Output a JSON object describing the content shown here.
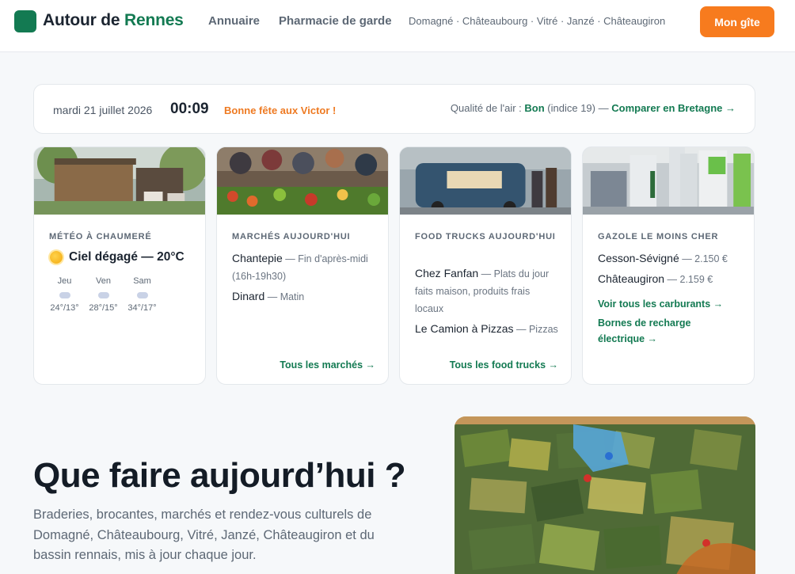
{
  "header": {
    "logo_text_a": "Autour de ",
    "logo_text_b": "Rennes",
    "nav": [
      {
        "label": "Annuaire"
      },
      {
        "label": "Pharmacie de garde"
      }
    ],
    "cities": "Domagné · Châteaubourg · Vitré · Janzé · Châteaugiron",
    "cta_label": "Mon gîte",
    "colors": {
      "brand": "#137a52",
      "accent": "#f77b1e"
    }
  },
  "infobar": {
    "date": "mardi 21 juillet 2026",
    "time": "00:09",
    "fete": "Bonne fête aux Victor !",
    "air_prefix": "Qualité de l'air : ",
    "air_value": "Bon",
    "air_index": " (indice 19) — ",
    "air_link": "Comparer en Bretagne →"
  },
  "cards": {
    "weather": {
      "kicker": "Météo à Chaumeré",
      "summary": "Ciel dégagé — 20°C",
      "icon": "sun-icon",
      "forecast": [
        {
          "day": "Jeu",
          "temp": "24°/13°"
        },
        {
          "day": "Ven",
          "temp": "28°/15°"
        },
        {
          "day": "Sam",
          "temp": "34°/17°"
        }
      ]
    },
    "markets": {
      "kicker": "Marchés aujourd'hui",
      "items": [
        {
          "name": "Chantepie",
          "detail": " — Fin d'après-midi (16h-19h30)"
        },
        {
          "name": "Dinard",
          "detail": " — Matin"
        }
      ],
      "link": "Tous les marchés →"
    },
    "foodtrucks": {
      "kicker": "Food trucks aujourd'hui",
      "items": [
        {
          "name": "Chez Fanfan",
          "detail": " — Plats du jour faits maison, produits frais locaux"
        },
        {
          "name": "Le Camion à Pizzas",
          "detail": " — Pizzas"
        }
      ],
      "link": "Tous les food trucks →"
    },
    "fuel": {
      "kicker": "Gazole le moins cher",
      "items": [
        {
          "name": "Cesson-Sévigné",
          "detail": " — 2.150 €"
        },
        {
          "name": "Châteaugiron",
          "detail": " — 2.159 €"
        }
      ],
      "link_1": "Voir tous les carburants →",
      "link_2": "Bornes de recharge électrique →"
    }
  },
  "hero": {
    "title": "Que faire aujourd’hui ?",
    "subtitle": "Braderies, brocantes, marchés et rendez-vous culturels de Domagné, Châteaubourg, Vitré, Janzé, Châteaugiron et du bassin rennais, mis à jour chaque jour."
  }
}
